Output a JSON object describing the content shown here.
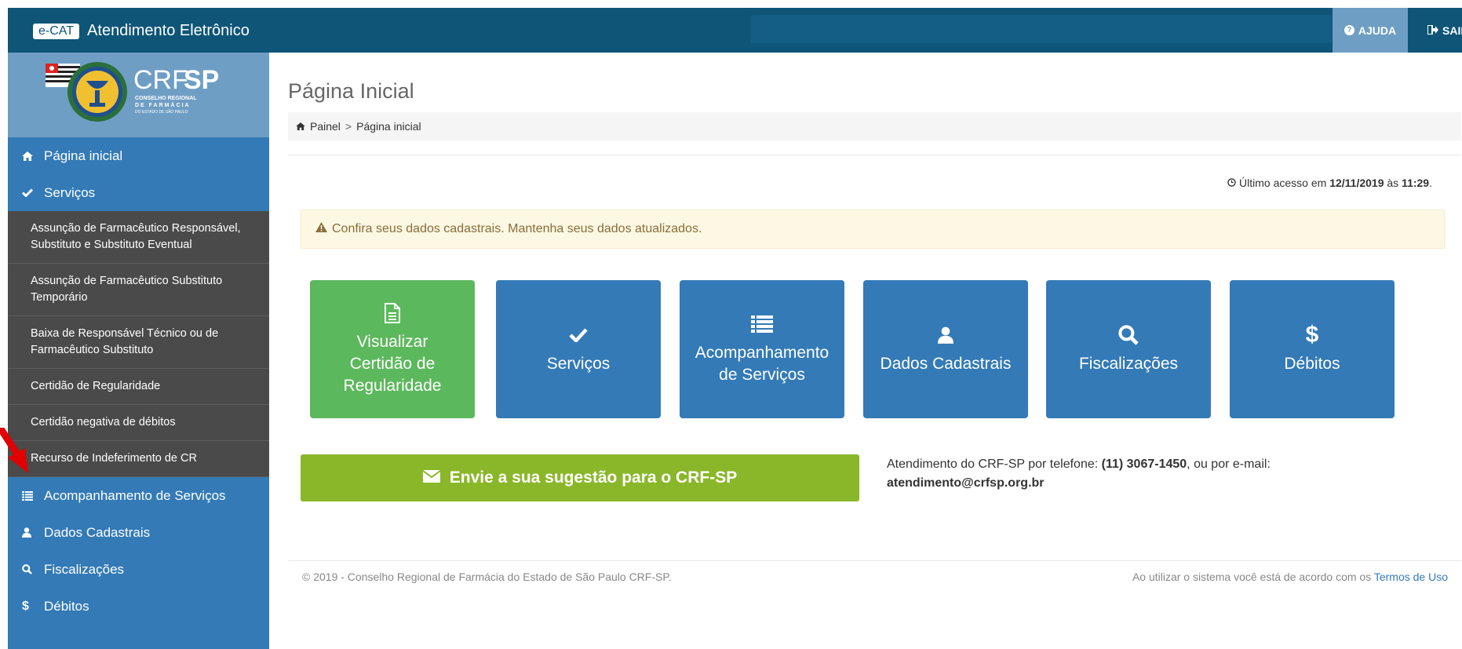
{
  "topbar": {
    "badge": "e-CAT",
    "title": "Atendimento Eletrônico",
    "help_label": "AJUDA",
    "exit_label": "SAIR"
  },
  "logo": {
    "name_a": "CRF",
    "name_b": "SP",
    "line1": "CONSELHO REGIONAL",
    "line2": "DE FARMÁCIA",
    "line3": "DO ESTADO DE SÃO PAULO"
  },
  "sidebar": {
    "home": "Página inicial",
    "services": "Serviços",
    "sub_items": [
      "Assunção de Farmacêutico Responsável, Substituto e Substituto Eventual",
      "Assunção de Farmacêutico Substituto Temporário",
      "Baixa de Responsável Técnico ou de Farmacêutico Substituto",
      "Certidão de Regularidade",
      "Certidão negativa de débitos",
      "Recurso de Indeferimento de CR"
    ],
    "tracking": "Acompanhamento de Serviços",
    "registration": "Dados Cadastrais",
    "inspections": "Fiscalizações",
    "debts": "Débitos"
  },
  "main": {
    "title": "Página Inicial",
    "breadcrumb_home": "Painel",
    "breadcrumb_sep": ">",
    "breadcrumb_current": "Página inicial",
    "last_access_prefix": "Último acesso em",
    "last_access_date": "12/11/2019",
    "last_access_mid": "às",
    "last_access_time": "11:29",
    "alert_text": "Confira seus dados cadastrais. Mantenha seus dados atualizados.",
    "tiles": [
      "Visualizar Certidão de Regularidade",
      "Serviços",
      "Acompanhamento de Serviços",
      "Dados Cadastrais",
      "Fiscalizações",
      "Débitos"
    ],
    "suggest_label": "Envie a sua sugestão para o CRF-SP",
    "contact_prefix": "Atendimento do CRF-SP por telefone:",
    "contact_phone": "(11) 3067-1450",
    "contact_mid": ", ou por e-mail:",
    "contact_email": "atendimento@crfsp.org.br"
  },
  "footer": {
    "copyright": "© 2019 - Conselho Regional de Farmácia do Estado de São Paulo CRF-SP.",
    "terms_prefix": "Ao utilizar o sistema você está de acordo com os",
    "terms_link": "Termos de Uso"
  },
  "colors": {
    "topbar": "#0e5578",
    "sidebar": "#337ab7",
    "submenu": "#4a4a4a",
    "tile_blue": "#337ab7",
    "tile_green": "#5cb85c",
    "suggest_green": "#8ab72a",
    "annotation_arrow": "#e00000"
  }
}
